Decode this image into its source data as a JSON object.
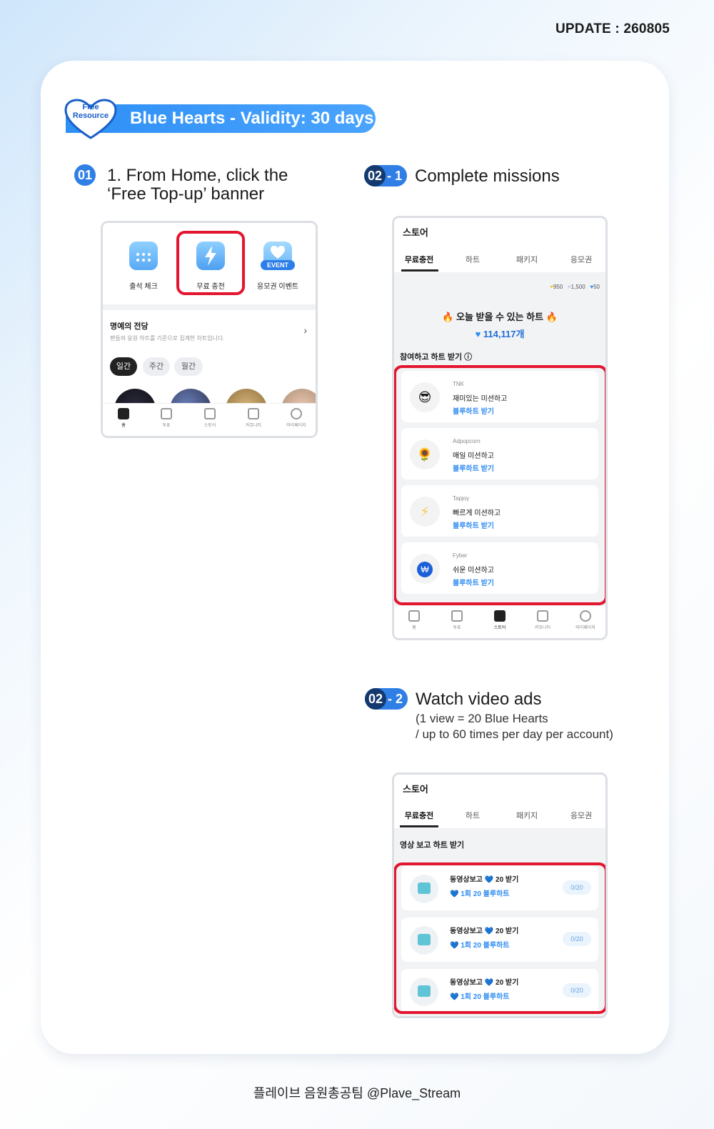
{
  "update": "UPDATE : 260805",
  "badge": {
    "line1": "Free",
    "line2": "Resource"
  },
  "banner": "Blue Hearts - Validity: 30 days",
  "step1": {
    "num": "01",
    "title1": "1. From Home, click the",
    "title2": "‘Free Top-up’ banner"
  },
  "step21": {
    "num": "02",
    "sub": "- 1",
    "title": "Complete missions"
  },
  "step22": {
    "num": "02",
    "sub": "- 2",
    "title": "Watch video ads",
    "line1": "(1 view = 20 Blue Hearts",
    "line2": "/ up to 60 times per day per account)"
  },
  "phone1": {
    "icons": [
      "출석 체크",
      "무료 충전",
      "응모권 이벤트"
    ],
    "event_label": "EVENT",
    "hall_title": "명예의 전당",
    "hall_sub": "팬들의 응원 하트를 기준으로 집계한 차트입니다.",
    "chips": [
      "일간",
      "주간",
      "월간"
    ],
    "nav": [
      "홈",
      "투표",
      "스토어",
      "커뮤니티",
      "마이페이지"
    ]
  },
  "store": {
    "title": "스토어",
    "tabs": [
      "무료충전",
      "하트",
      "패키지",
      "응모권"
    ],
    "balances": [
      "950",
      "1,500",
      "50"
    ],
    "today_label": "🔥 오늘 받을 수 있는 하트 🔥",
    "today_value": "114,117개",
    "mission_section": "참여하고 하트 받기 ⓘ",
    "missions": [
      {
        "provider": "TNK",
        "title": "재미있는 미션하고",
        "action": "블루하트 받기",
        "icon": "sunglasses-icon"
      },
      {
        "provider": "Adpopcorn",
        "title": "매일 미션하고",
        "action": "블루하트 받기",
        "icon": "sunflower-icon"
      },
      {
        "provider": "Tapjoy",
        "title": "빠르게 미션하고",
        "action": "블루하트 받기",
        "icon": "lightning-icon"
      },
      {
        "provider": "Fyber",
        "title": "쉬운 미션하고",
        "action": "블루하트 받기",
        "icon": "won-icon"
      }
    ],
    "nav": [
      "홈",
      "투표",
      "스토어",
      "커뮤니티",
      "마이페이지"
    ],
    "video_section": "영상 보고 하트 받기",
    "videos": [
      {
        "title": "동영상보고 💙 20 받기",
        "sub": "💙 1회 20 블루하트",
        "count": "0/20"
      },
      {
        "title": "동영상보고 💙 20 받기",
        "sub": "💙 1회 20 블루하트",
        "count": "0/20"
      },
      {
        "title": "동영상보고 💙 20 받기",
        "sub": "💙 1회 20 블루하트",
        "count": "0/20"
      }
    ]
  },
  "footer": "플레이브 음원총공팀 @Plave_Stream"
}
